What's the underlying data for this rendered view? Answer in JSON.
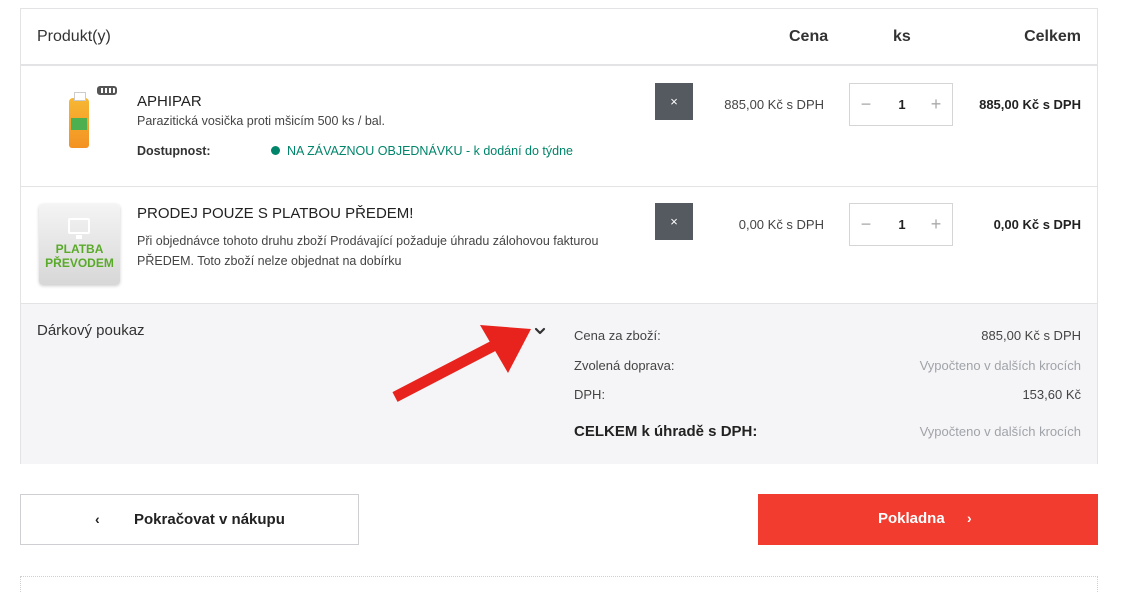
{
  "header": {
    "product": "Produkt(y)",
    "price": "Cena",
    "qty": "ks",
    "total": "Celkem"
  },
  "items": [
    {
      "name": "APHIPAR",
      "description": "Parazitická vosička proti mšicím 500 ks / bal.",
      "availability_label": "Dostupnost:",
      "availability_value": "NA ZÁVAZNOU OBJEDNÁVKU - k dodání do týdne",
      "remove_label": "×",
      "price": "885,00 Kč s DPH",
      "quantity": "1",
      "total": "885,00 Kč s DPH"
    },
    {
      "name": "PRODEJ POUZE S PLATBOU PŘEDEM!",
      "description_line1": "Při objednávce tohoto druhu zboží Prodávající požaduje úhradu zálohovou fakturou",
      "description_line2": "PŘEDEM. Toto zboží nelze objednat na dobírku",
      "image_text_1": "PLATBA",
      "image_text_2": "PŘEVODEM",
      "remove_label": "×",
      "price": "0,00 Kč s DPH",
      "quantity": "1",
      "total": "0,00 Kč s DPH"
    }
  ],
  "qty_controls": {
    "minus": "−",
    "plus": "+"
  },
  "voucher": {
    "label": "Dárkový poukaz"
  },
  "summary": {
    "goods_label": "Cena za zboží:",
    "goods_value": "885,00 Kč s DPH",
    "shipping_label": "Zvolená doprava:",
    "shipping_value": "Vypočteno v dalších krocích",
    "vat_label": "DPH:",
    "vat_value": "153,60 Kč",
    "grand_total_label": "CELKEM k úhradě s DPH:",
    "grand_total_value": "Vypočteno v dalších krocích"
  },
  "buttons": {
    "back_chevron": "‹",
    "back_label": "Pokračovat v nákupu",
    "checkout_label": "Pokladna",
    "checkout_chevron": "›"
  },
  "colors": {
    "accent_red": "#f23c2f",
    "availability_green": "#00846a",
    "remove_button": "#545a60",
    "annotation_arrow": "#e8231d"
  },
  "icons": {
    "remove": "close-icon",
    "voucher_toggle": "chevron-down-icon",
    "back": "chevron-left-icon",
    "checkout": "chevron-right-icon",
    "annotation": "red-arrow-icon"
  }
}
